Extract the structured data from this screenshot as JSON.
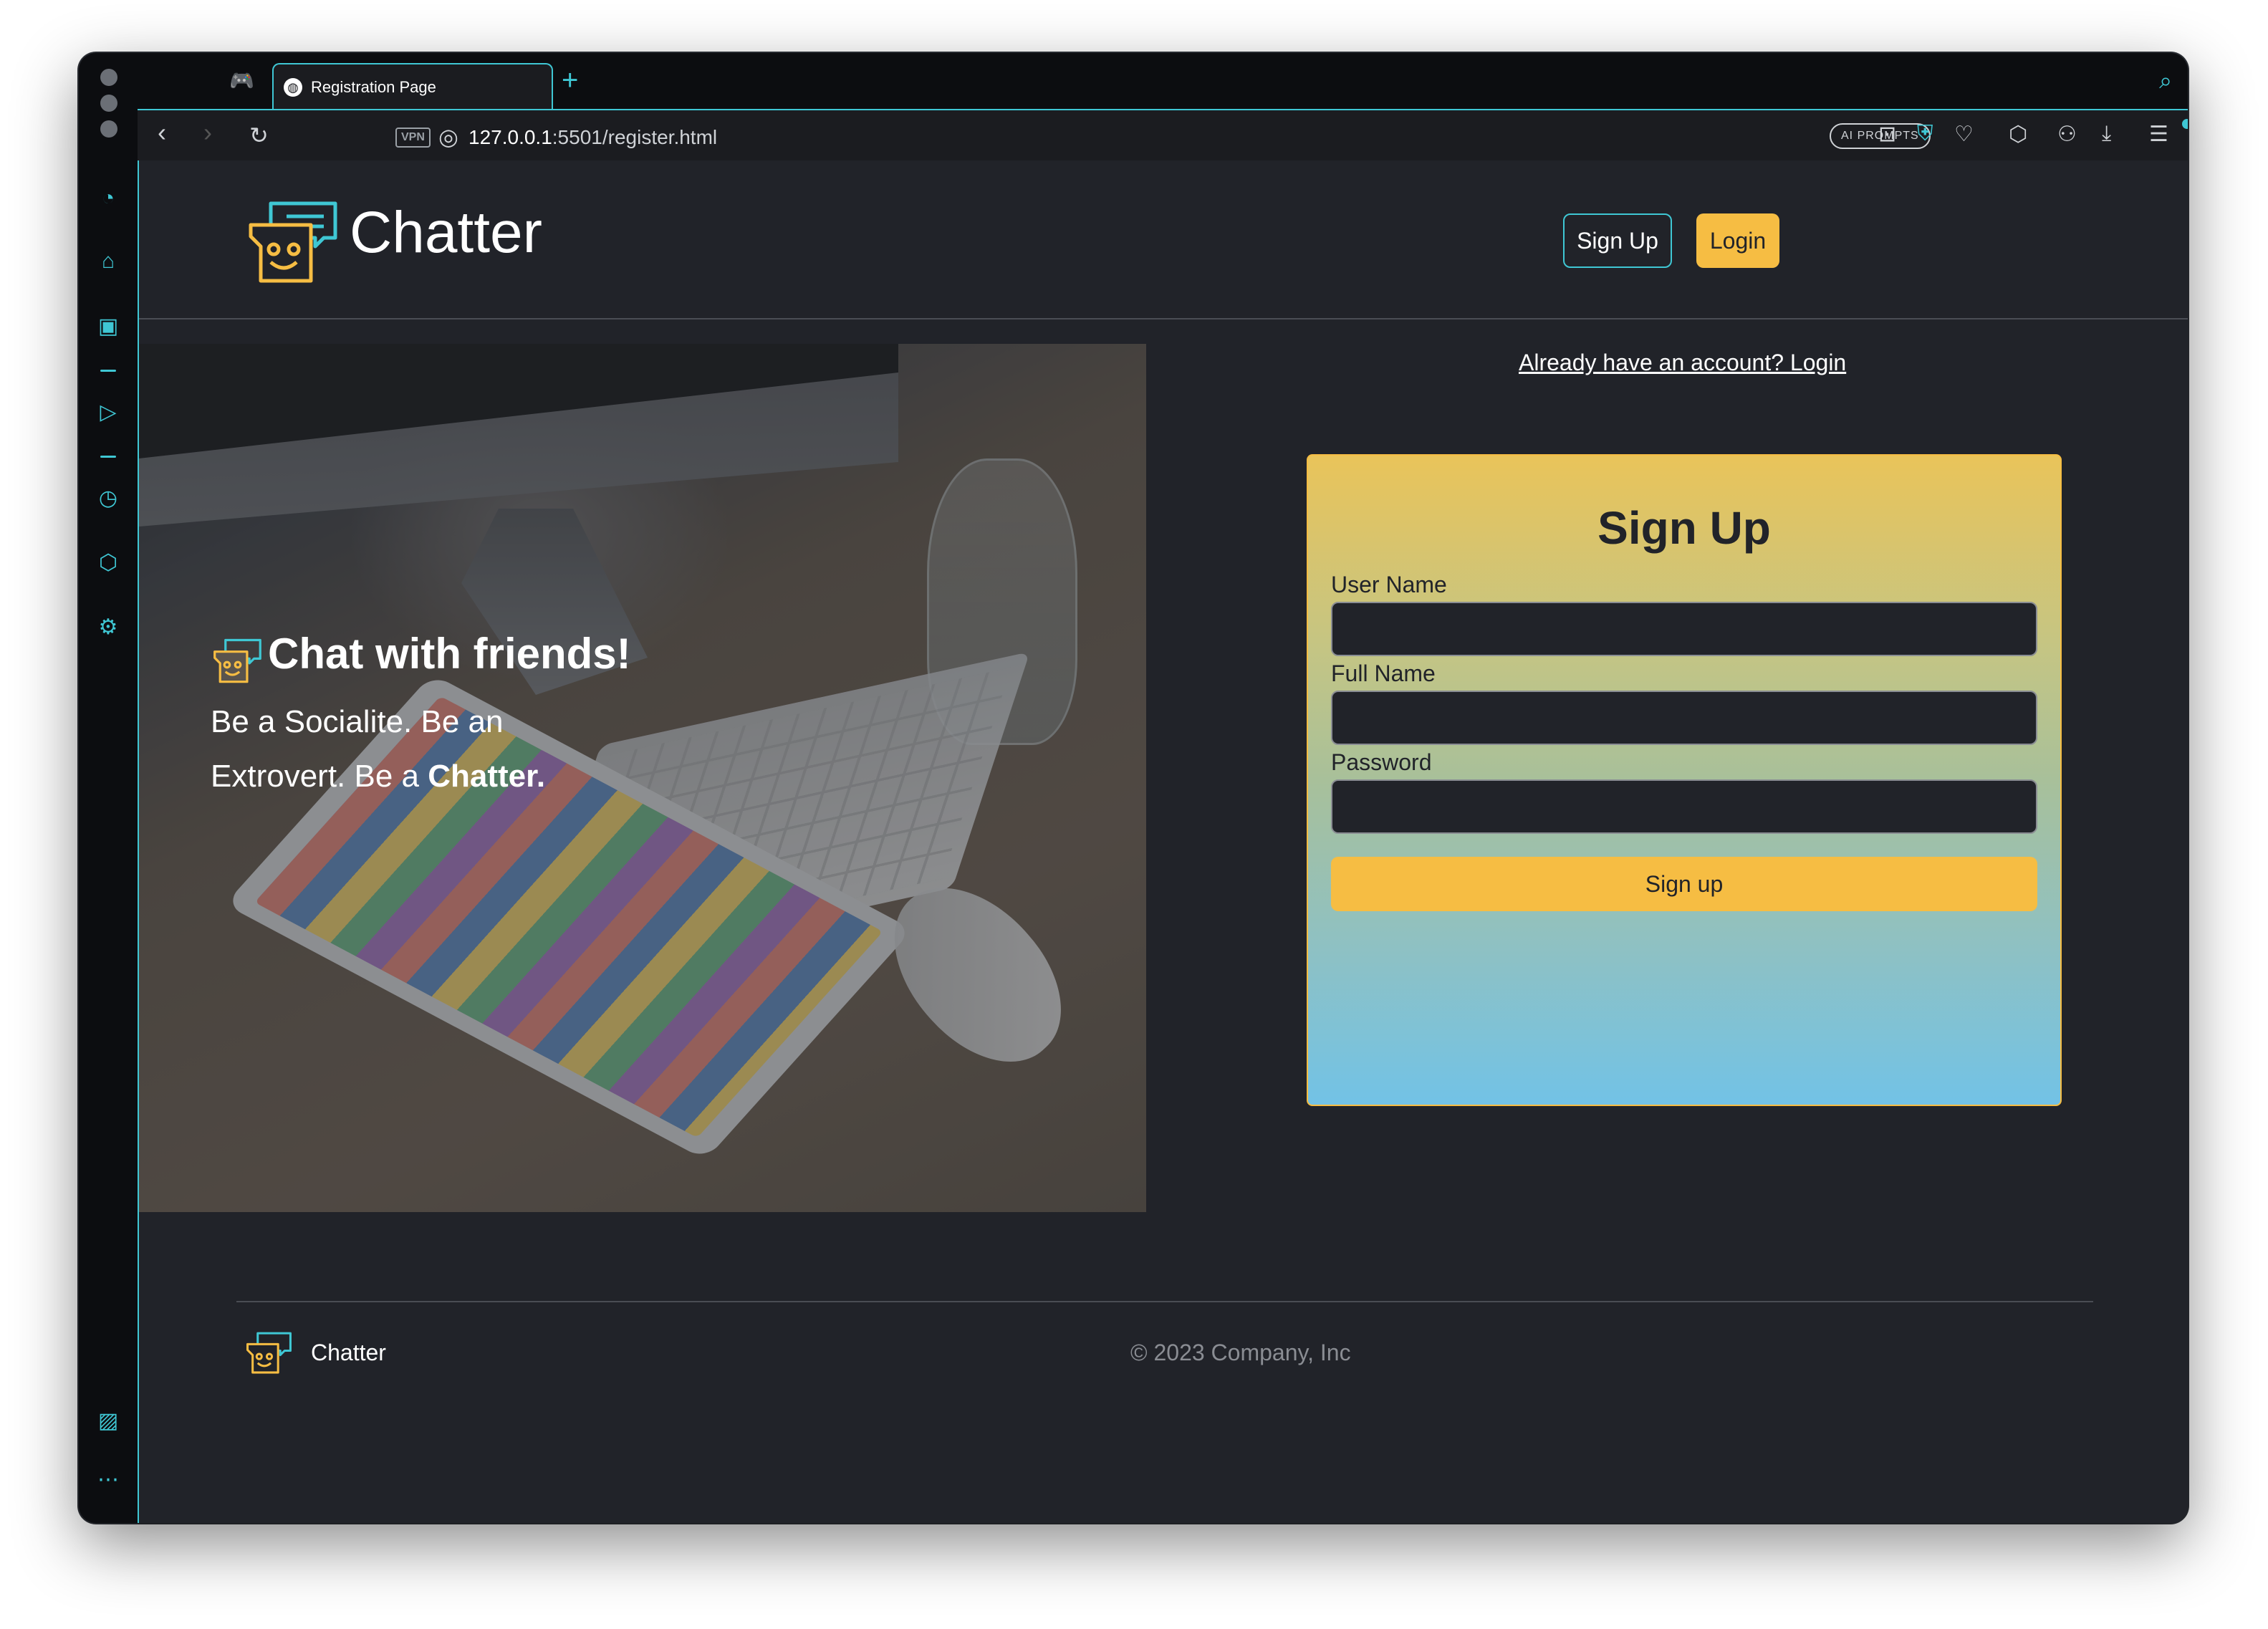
{
  "browser": {
    "tab_title": "Registration Page",
    "url_host": "127.0.0.1",
    "url_rest": ":5501/register.html",
    "vpn_label": "VPN",
    "ai_prompts_label": "AI PROMPTS"
  },
  "header": {
    "brand": "Chatter",
    "signup_label": "Sign Up",
    "login_label": "Login"
  },
  "hero": {
    "title": "Chat with friends!",
    "sub_prefix": "Be a Socialite. Be an Extrovert. Be a ",
    "sub_bold": "Chatter."
  },
  "form": {
    "already_link": "Already have an account? Login",
    "title": "Sign Up",
    "username_label": "User Name",
    "fullname_label": "Full Name",
    "password_label": "Password",
    "submit_label": "Sign up"
  },
  "footer": {
    "brand": "Chatter",
    "copyright": "© 2023 Company, Inc"
  },
  "colors": {
    "accent": "#3fc7d4",
    "brand_yellow": "#f6bd43",
    "page_bg": "#212329"
  }
}
